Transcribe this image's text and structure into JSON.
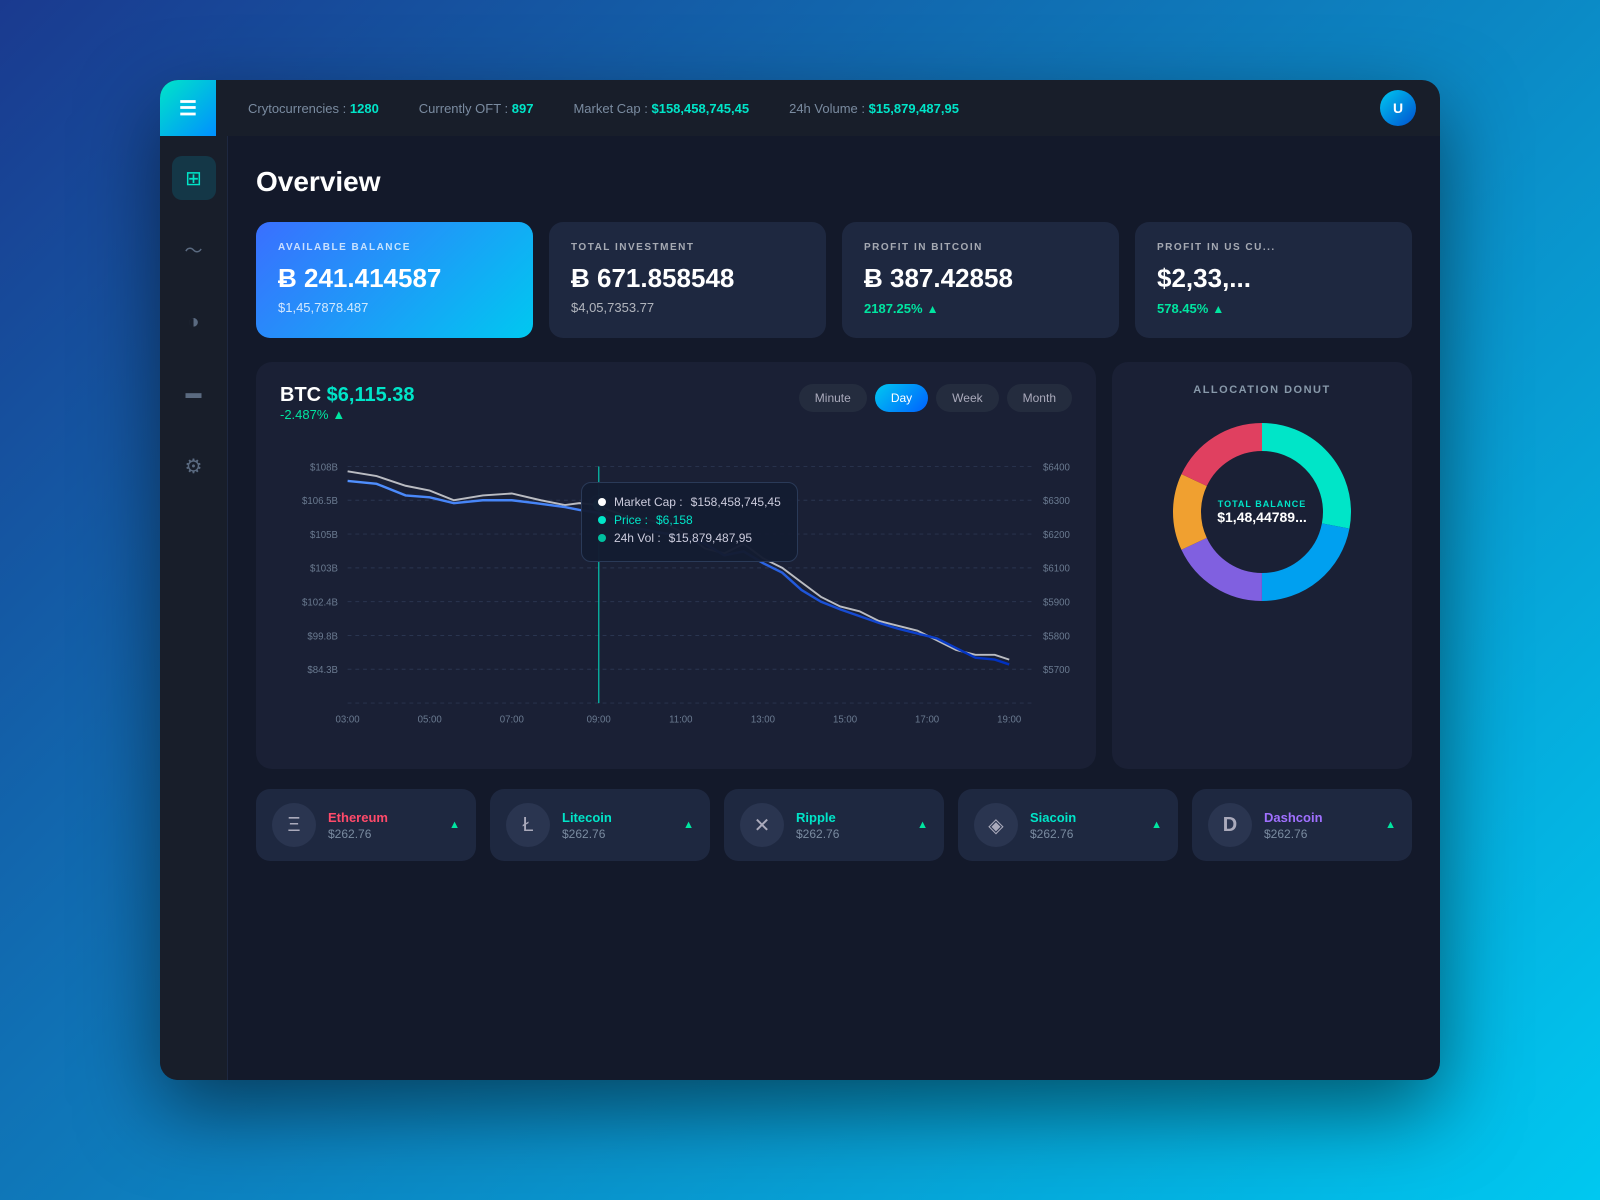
{
  "topbar": {
    "menu_icon": "☰",
    "stats": [
      {
        "label": "Crytocurrencies : ",
        "value": "1280"
      },
      {
        "label": "Currently OFT : ",
        "value": "897"
      },
      {
        "label": "Market Cap : ",
        "value": "$158,458,745,45"
      },
      {
        "label": "24h Volume : ",
        "value": "$15,879,487,95"
      }
    ],
    "avatar_initials": "U"
  },
  "sidebar": {
    "items": [
      {
        "id": "dashboard",
        "icon": "⊞",
        "active": true
      },
      {
        "id": "chart",
        "icon": "∿"
      },
      {
        "id": "pie",
        "icon": "◑"
      },
      {
        "id": "card",
        "icon": "▬"
      },
      {
        "id": "settings",
        "icon": "⚙"
      }
    ]
  },
  "page": {
    "title": "Overview"
  },
  "stat_cards": [
    {
      "id": "available-balance",
      "featured": true,
      "label": "AVAILABLE BALANCE",
      "value": "Ƀ 241.414587",
      "sub": "$1,45,7878.487"
    },
    {
      "id": "total-investment",
      "featured": false,
      "label": "TOTAL INVESTMENT",
      "value": "Ƀ 671.858548",
      "sub": "$4,05,7353.77",
      "pct": null
    },
    {
      "id": "profit-btc",
      "featured": false,
      "label": "PROFIT IN BITCOIN",
      "value": "Ƀ 387.42858",
      "sub": "2187.25%",
      "pct_up": true
    },
    {
      "id": "profit-usd",
      "featured": false,
      "label": "PROFIT IN US CU...",
      "value": "$2,33,...",
      "sub": "578.45%",
      "pct_up": true
    }
  ],
  "chart": {
    "title": "BTC",
    "price": "$6,115.38",
    "change": "-2.487%",
    "change_up": true,
    "time_buttons": [
      "Minute",
      "Day",
      "Week",
      "Month"
    ],
    "active_time": "Day",
    "y_left_labels": [
      "$108B",
      "$106.5B",
      "$105B",
      "$103B",
      "$102.4B",
      "$99.8B",
      "$84.3B"
    ],
    "y_right_labels": [
      "$6400",
      "$6300",
      "$6200",
      "$6100",
      "$5900",
      "$5800",
      "$5700"
    ],
    "x_labels": [
      "03:00",
      "05:00",
      "07:00",
      "09:00",
      "11:00",
      "13:00",
      "15:00",
      "17:00",
      "19:00"
    ],
    "tooltip": {
      "market_cap": "$158,458,745,45",
      "price": "$6,158",
      "vol_24h": "$15,879,487,95"
    }
  },
  "donut": {
    "title": "ALLOCATION DONUT",
    "center_label": "TOTAL BALANCE",
    "center_value": "$1,48,44789...",
    "segments": [
      {
        "color": "#00e5c8",
        "pct": 28
      },
      {
        "color": "#00a0f0",
        "pct": 22
      },
      {
        "color": "#8060e0",
        "pct": 18
      },
      {
        "color": "#f0a030",
        "pct": 14
      },
      {
        "color": "#e04060",
        "pct": 18
      }
    ]
  },
  "coins": [
    {
      "id": "eth",
      "name": "Ethereum",
      "name_color": "#ff4a6a",
      "icon": "Ξ",
      "price": "$262.76",
      "change": "▲",
      "change_dir": "up"
    },
    {
      "id": "ltc",
      "name": "Litecoin",
      "name_color": "#00e5c8",
      "icon": "Ł",
      "price": "$262.76",
      "change": "▲",
      "change_dir": "up"
    },
    {
      "id": "xrp",
      "name": "Ripple",
      "name_color": "#00e5c8",
      "icon": "✕",
      "price": "$262.76",
      "change": "▲",
      "change_dir": "up"
    },
    {
      "id": "sc",
      "name": "Siacoin",
      "name_color": "#00e5c8",
      "icon": "◈",
      "price": "$262.76",
      "change": "▲",
      "change_dir": "up"
    },
    {
      "id": "dash",
      "name": "Dashcoin",
      "name_color": "#a070ff",
      "icon": "D",
      "price": "$262.76",
      "change": "▲",
      "change_dir": "up"
    }
  ]
}
